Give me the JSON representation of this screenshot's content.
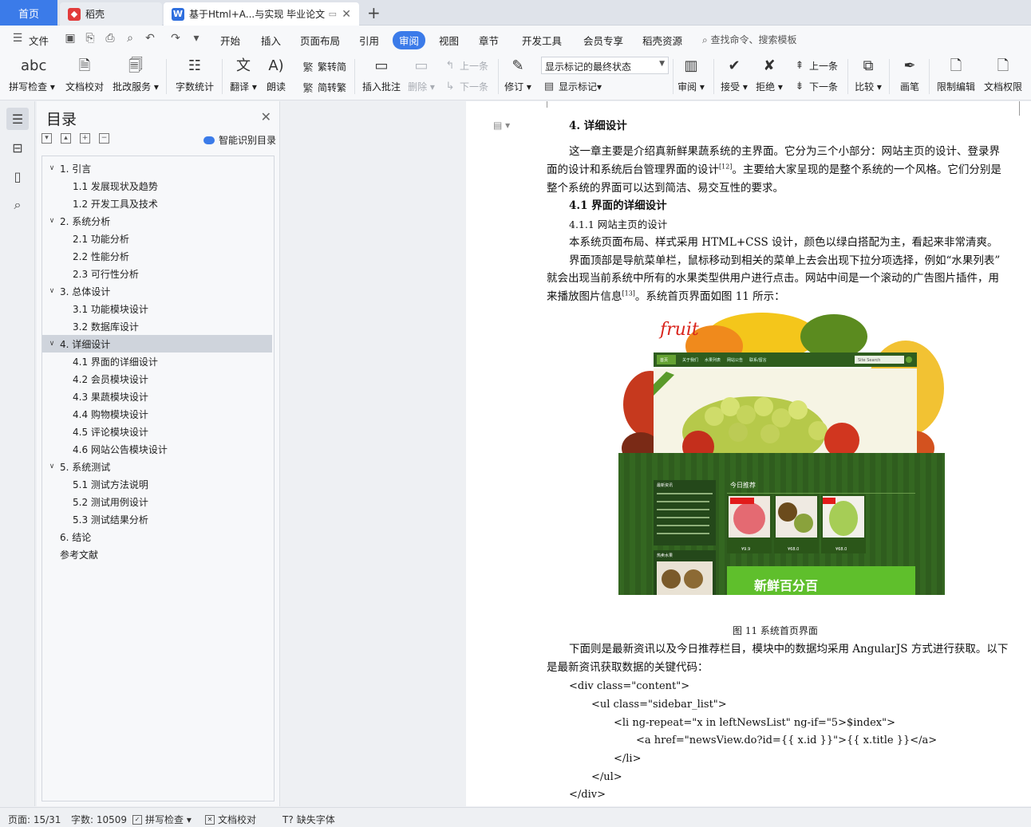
{
  "tabs": {
    "home": "首页",
    "docer": "稻壳",
    "doc_title": "基于Html+A...与实现 毕业论文"
  },
  "menu": {
    "file": "文件",
    "items": [
      "开始",
      "插入",
      "页面布局",
      "引用",
      "审阅",
      "视图",
      "章节",
      "开发工具",
      "会员专享",
      "稻壳资源"
    ],
    "search": "查找命令、搜索模板"
  },
  "ribbon": {
    "spell": "拼写检查",
    "proof": "文档校对",
    "annot": "批改服务",
    "wordcount": "字数统计",
    "translate": "翻译",
    "read": "朗读",
    "trad2simp": "繁转简",
    "simp2trad": "简转繁",
    "insert_comment": "插入批注",
    "delete": "删除",
    "prev": "上一条",
    "next": "下一条",
    "revise": "修订",
    "markup_select": "显示标记的最终状态",
    "show_markup": "显示标记",
    "review": "审阅",
    "accept": "接受",
    "reject": "拒绝",
    "prev2": "上一条",
    "next2": "下一条",
    "compare": "比较",
    "pen": "画笔",
    "restrict": "限制编辑",
    "rights": "文档权限"
  },
  "toc": {
    "title": "目录",
    "smart": "智能识别目录",
    "items": [
      {
        "label": "1. 引言",
        "level": 1
      },
      {
        "label": "1.1 发展现状及趋势",
        "level": 2
      },
      {
        "label": "1.2 开发工具及技术",
        "level": 2
      },
      {
        "label": "2. 系统分析",
        "level": 1
      },
      {
        "label": "2.1  功能分析",
        "level": 2
      },
      {
        "label": "2.2  性能分析",
        "level": 2
      },
      {
        "label": "2.3  可行性分析",
        "level": 2
      },
      {
        "label": "3. 总体设计",
        "level": 1
      },
      {
        "label": "3.1  功能模块设计",
        "level": 2
      },
      {
        "label": "3.2  数据库设计",
        "level": 2
      },
      {
        "label": "4. 详细设计",
        "level": 1
      },
      {
        "label": "4.1 界面的详细设计",
        "level": 2
      },
      {
        "label": "4.2  会员模块设计",
        "level": 2
      },
      {
        "label": "4.3  果蔬模块设计",
        "level": 2
      },
      {
        "label": "4.4  购物模块设计",
        "level": 2
      },
      {
        "label": "4.5  评论模块设计",
        "level": 2
      },
      {
        "label": "4.6  网站公告模块设计",
        "level": 2
      },
      {
        "label": "5. 系统测试",
        "level": 1
      },
      {
        "label": "5.1  测试方法说明",
        "level": 2
      },
      {
        "label": "5.2  测试用例设计",
        "level": 2
      },
      {
        "label": "5.3  测试结果分析",
        "level": 2
      },
      {
        "label": "6. 结论",
        "level": 1
      },
      {
        "label": "参考文献",
        "level": 0
      }
    ]
  },
  "doc": {
    "h4": "4.  详细设计",
    "p1a": "这一章主要是介绍真新鲜果蔬系统的主界面。它分为三个小部分：网站主页的设计、登录界",
    "p1b": "面的设计和系统后台管理界面的设计",
    "p1b_sup": "[12]",
    "p1b_tail": "。主要给大家呈现的是整个系统的一个风格。它们分别是",
    "p1c": "整个系统的界面可以达到简洁、易交互性的要求。",
    "h41": "4.1 界面的详细设计",
    "h411": "4.1.1  网站主页的设计",
    "p2": "本系统页面布局、样式采用 HTML+CSS 设计，颜色以绿白搭配为主，看起来非常清爽。",
    "p3a": "界面顶部是导航菜单栏，鼠标移动到相关的菜单上去会出现下拉分项选择，例如“水果列表”",
    "p3b": "就会出现当前系统中所有的水果类型供用户进行点击。网站中间是一个滚动的广告图片插件，用",
    "p3c": "来播放图片信息",
    "p3c_sup": "[13]",
    "p3c_tail": "。系统首页界面如图 11 所示：",
    "caption": "图 11    系统首页界面",
    "p4a": "下面则是最新资讯以及今日推荐栏目，模块中的数据均采用 AngularJS 方式进行获取。以下",
    "p4b": "是最新资讯获取数据的关键代码：",
    "code1": "<div class=\"content\">",
    "code2": "<ul class=\"sidebar_list\">",
    "code3": "<li ng-repeat=\"x in leftNewsList\" ng-if=\"5>$index\">",
    "code4": "<a href=\"newsView.do?id={{ x.id }}\">{{ x.title }}</a>",
    "code5": "</li>",
    "code6": "</ul>",
    "code7": "</div>"
  },
  "figure": {
    "logo": "fruit",
    "nav": [
      "首页",
      "关于我们",
      "水果列表",
      "网站公告",
      "联系/留言"
    ],
    "search": "Site Search",
    "news_title": "最新资讯",
    "rec_title": "今日推荐",
    "hot_title": "热卖水果",
    "banner": "新鲜百分百",
    "prices": [
      "¥9.9",
      "¥68.0",
      "¥68.0"
    ]
  },
  "status": {
    "page": "页面: 15/31",
    "words": "字数: 10509",
    "spell": "拼写检查",
    "proof": "文档校对",
    "font": "缺失字体"
  },
  "colors": {
    "accent": "#3b7be9",
    "site_green": "#2f5d1e"
  }
}
